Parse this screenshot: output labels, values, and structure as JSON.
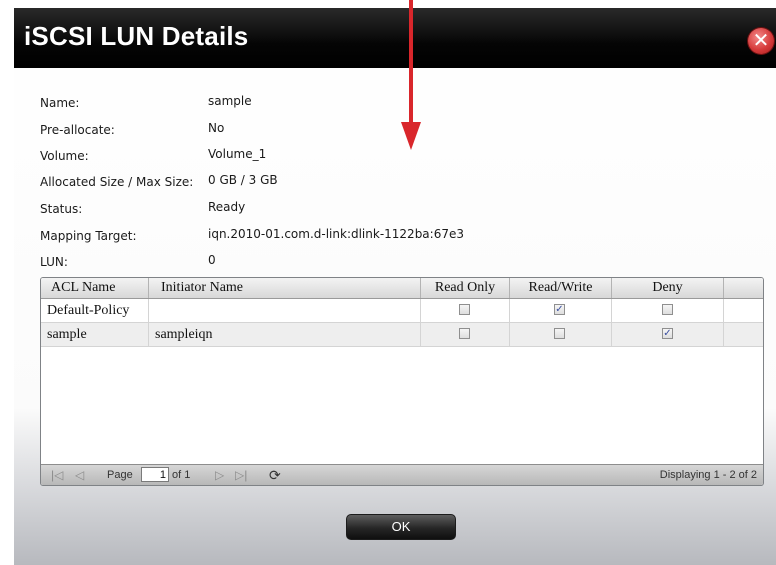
{
  "window": {
    "title": "iSCSI LUN Details",
    "close_glyph": "✕"
  },
  "fields": [
    {
      "label": "Name:",
      "value": "sample"
    },
    {
      "label": "Pre-allocate:",
      "value": "No"
    },
    {
      "label": "Volume:",
      "value": "Volume_1"
    },
    {
      "label": "Allocated Size / Max Size:",
      "value": "0 GB / 3 GB"
    },
    {
      "label": "Status:",
      "value": "Ready"
    },
    {
      "label": "Mapping Target:",
      "value": "iqn.2010-01.com.d-link:dlink-1122ba:67e3"
    },
    {
      "label": "LUN:",
      "value": "0"
    }
  ],
  "acl_table": {
    "columns": [
      "ACL Name",
      "Initiator Name",
      "Read Only",
      "Read/Write",
      "Deny"
    ],
    "rows": [
      {
        "acl_name": "Default-Policy",
        "initiator": "",
        "read_only": false,
        "read_write": true,
        "deny": false
      },
      {
        "acl_name": "sample",
        "initiator": "sampleiqn",
        "read_only": false,
        "read_write": false,
        "deny": true
      }
    ],
    "check_glyph": "✓"
  },
  "pager": {
    "first_icon": "first-page-icon",
    "prev_icon": "prev-page-icon",
    "next_icon": "next-page-icon",
    "last_icon": "last-page-icon",
    "refresh_icon": "refresh-icon",
    "first_glyph": "|◁",
    "prev_glyph": "◁",
    "next_glyph": "▷",
    "last_glyph": "▷|",
    "refresh_glyph": "⟳",
    "page_label": "Page",
    "page_value": "1",
    "of_label": "of 1",
    "display_text": "Displaying 1 - 2 of 2"
  },
  "ok_button": {
    "label": "OK"
  },
  "colors": {
    "annotation_arrow": "#d9262b",
    "titlebar": "#000000",
    "close_button": "#d63b3b"
  }
}
